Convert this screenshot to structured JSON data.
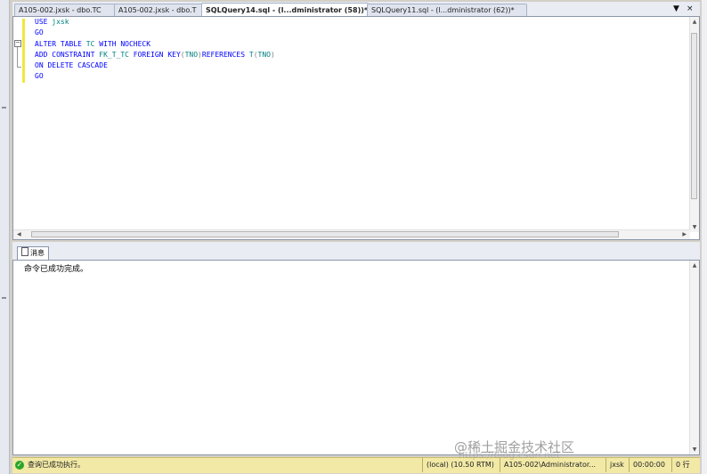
{
  "tabs": [
    {
      "label": "A105-002.jxsk - dbo.TC",
      "active": false
    },
    {
      "label": "A105-002.jxsk - dbo.T",
      "active": false
    },
    {
      "label": "SQLQuery14.sql - (l...dministrator (58))*",
      "active": true
    },
    {
      "label": "SQLQuery11.sql - (l...dministrator (62))*",
      "active": false
    }
  ],
  "tab_controls": {
    "dropdown": "▼",
    "close": "×"
  },
  "editor": {
    "lines": [
      [
        {
          "t": "USE ",
          "c": "kw"
        },
        {
          "t": "jxsk",
          "c": "id"
        }
      ],
      [
        {
          "t": "GO",
          "c": "kw"
        }
      ],
      [
        {
          "t": "ALTER TABLE ",
          "c": "kw"
        },
        {
          "t": "TC ",
          "c": "id"
        },
        {
          "t": "WITH NOCHECK",
          "c": "kw"
        }
      ],
      [
        {
          "t": "ADD CONSTRAINT ",
          "c": "kw"
        },
        {
          "t": "FK_T_TC ",
          "c": "id"
        },
        {
          "t": "FOREIGN KEY",
          "c": "kw"
        },
        {
          "t": "(",
          "c": "gr"
        },
        {
          "t": "TNO",
          "c": "id"
        },
        {
          "t": ")",
          "c": "gr"
        },
        {
          "t": "REFERENCES ",
          "c": "kw"
        },
        {
          "t": "T",
          "c": "id"
        },
        {
          "t": "(",
          "c": "gr"
        },
        {
          "t": "TNO",
          "c": "id"
        },
        {
          "t": ")",
          "c": "gr"
        }
      ],
      [
        {
          "t": "ON DELETE CASCADE",
          "c": "kw"
        }
      ],
      [
        {
          "t": "GO",
          "c": "kw"
        }
      ]
    ]
  },
  "results": {
    "tab_label": "消息",
    "message": "命令已成功完成。"
  },
  "status": {
    "text": "查询已成功执行。",
    "server": "(local) (10.50 RTM)",
    "user": "A105-002\\Administrator...",
    "database": "jxsk",
    "elapsed": "00:00:00",
    "rows": "0 行"
  },
  "colors": {
    "keyword": "#0000ff",
    "identifier": "#008080",
    "status_bg": "#f2e9a6"
  },
  "watermark": {
    "text": "@稀土掘金技术社区",
    "url": "https://blog.csdn.net"
  }
}
